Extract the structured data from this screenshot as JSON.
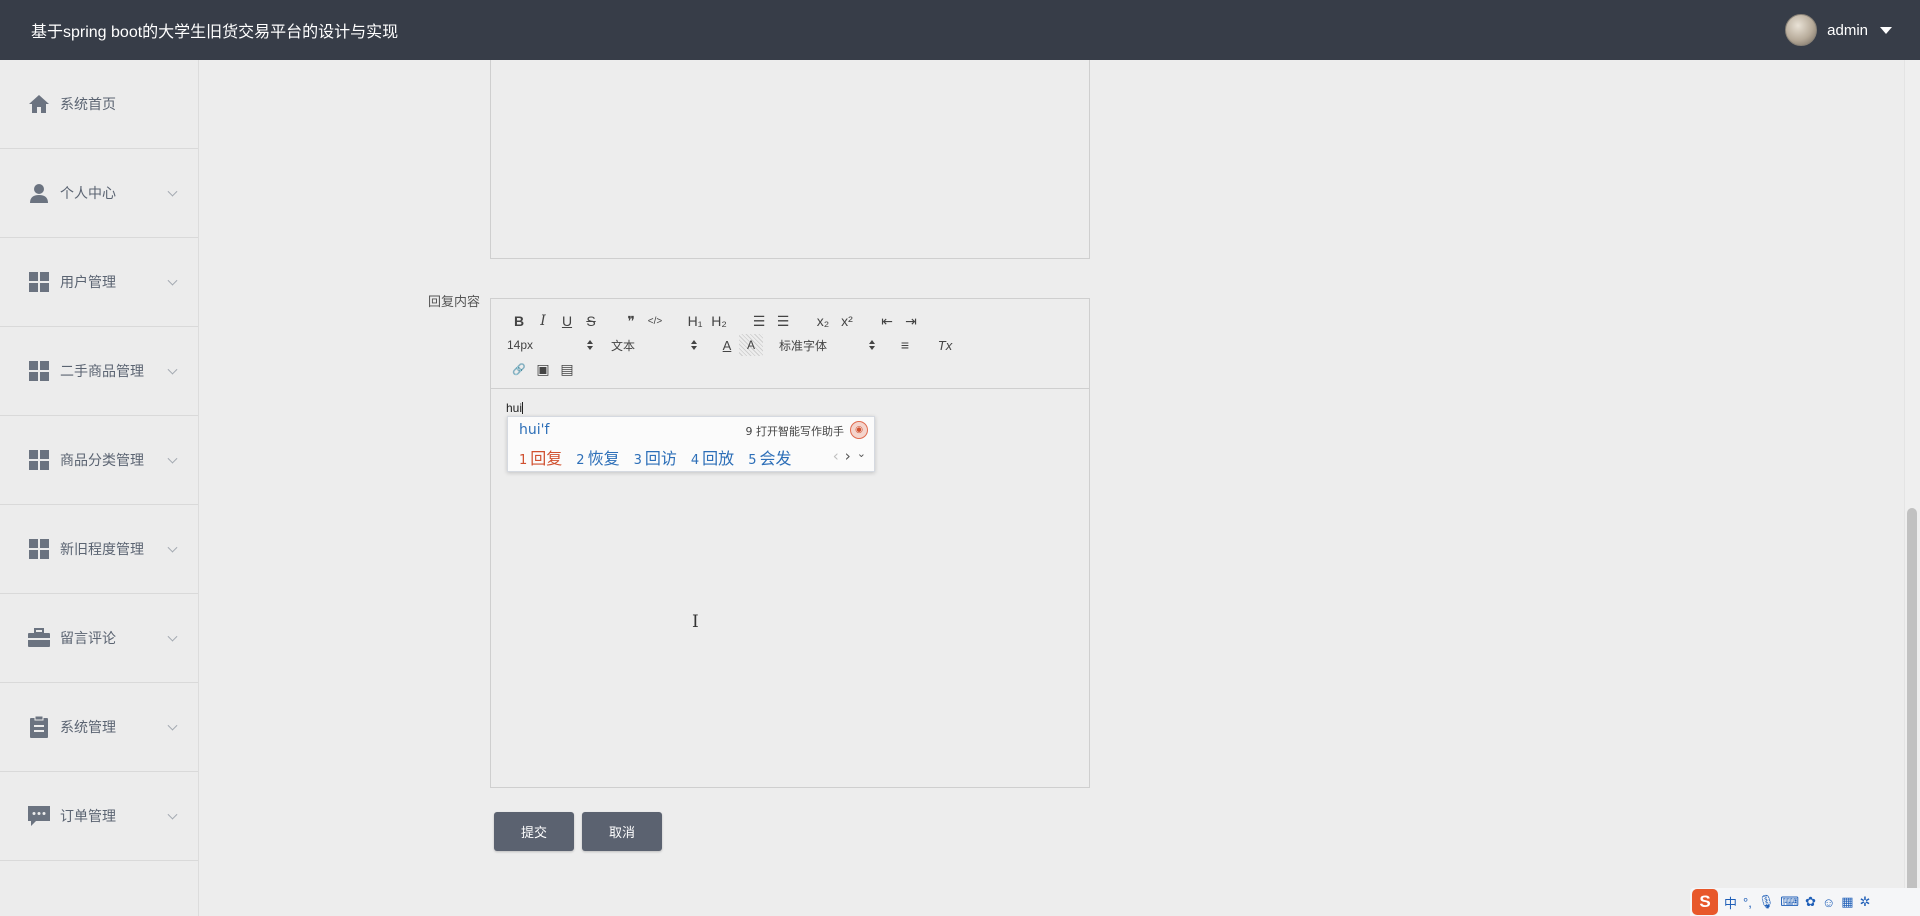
{
  "header": {
    "title": "基于spring boot的大学生旧货交易平台的设计与实现",
    "username": "admin"
  },
  "sidebar": {
    "items": [
      {
        "label": "系统首页",
        "icon": "home-icon",
        "expandable": false
      },
      {
        "label": "个人中心",
        "icon": "person-icon",
        "expandable": true
      },
      {
        "label": "用户管理",
        "icon": "grid-icon",
        "expandable": true
      },
      {
        "label": "二手商品管理",
        "icon": "grid-icon",
        "expandable": true
      },
      {
        "label": "商品分类管理",
        "icon": "grid-icon",
        "expandable": true
      },
      {
        "label": "新旧程度管理",
        "icon": "grid-icon",
        "expandable": true
      },
      {
        "label": "留言评论",
        "icon": "briefcase-icon",
        "expandable": true
      },
      {
        "label": "系统管理",
        "icon": "clipboard-icon",
        "expandable": true
      },
      {
        "label": "订单管理",
        "icon": "chat-icon",
        "expandable": true
      }
    ]
  },
  "form": {
    "reply_label": "回复内容",
    "submit_label": "提交",
    "cancel_label": "取消"
  },
  "editor": {
    "toolbar": {
      "bold": "B",
      "italic": "I",
      "underline": "U",
      "strike": "S",
      "blockquote": "❞",
      "code": "</>",
      "h1": "H₁",
      "h2": "H₂",
      "ordered_list": "☰",
      "bullet_list": "☰",
      "subscript": "x₂",
      "superscript": "x²",
      "outdent": "⇤",
      "indent": "⇥",
      "font_size": "14px",
      "header_select": "文本",
      "font_color": "A",
      "bg_color": "A",
      "font_family": "标准字体",
      "align": "≡",
      "clean": "Tx",
      "link": "🔗",
      "image": "▣",
      "video": "▤"
    },
    "content_text": "hui"
  },
  "ime": {
    "pinyin": "hui'f",
    "hint_num": "9",
    "hint_text": "打开智能写作助手",
    "candidates": [
      {
        "num": "1",
        "text": "回复"
      },
      {
        "num": "2",
        "text": "恢复"
      },
      {
        "num": "3",
        "text": "回访"
      },
      {
        "num": "4",
        "text": "回放"
      },
      {
        "num": "5",
        "text": "会发"
      }
    ]
  },
  "systray": {
    "ime_logo": "S",
    "lang": "中"
  }
}
